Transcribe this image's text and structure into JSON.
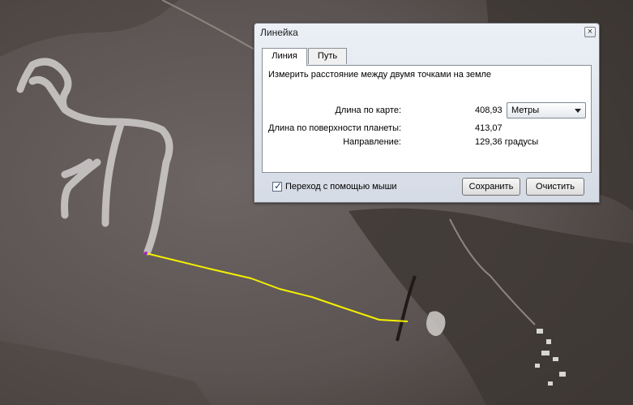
{
  "dialog": {
    "title": "Линейка",
    "tabs": [
      {
        "label": "Линия",
        "active": true
      },
      {
        "label": "Путь",
        "active": false
      }
    ],
    "description": "Измерить расстояние между двумя точками на земле",
    "map_length_label": "Длина по карте:",
    "map_length_value": "408,93",
    "units_selected": "Метры",
    "surface_length_label": "Длина по поверхности планеты:",
    "surface_length_value": "413,07",
    "heading_label": "Направление:",
    "heading_value": "129,36 градусы",
    "mouse_nav_label": "Переход с помощью мыши",
    "mouse_nav_checked": true,
    "save_label": "Сохранить",
    "clear_label": "Очистить"
  },
  "measure_line_color": "#f4f000",
  "accent_colors": {
    "terrain": "#5b5250",
    "geoglyph": "#c9c6c4"
  }
}
